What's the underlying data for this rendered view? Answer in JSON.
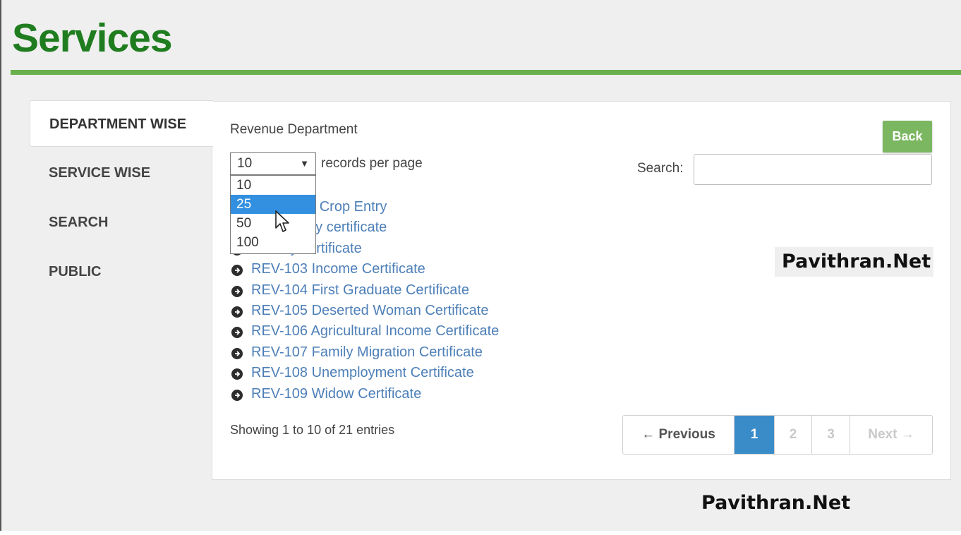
{
  "page": {
    "title": "Services"
  },
  "tabs": [
    {
      "label": "DEPARTMENT WISE",
      "active": true
    },
    {
      "label": "SERVICE WISE",
      "active": false
    },
    {
      "label": "SEARCH",
      "active": false
    },
    {
      "label": "PUBLIC",
      "active": false
    }
  ],
  "panel": {
    "department": "Revenue Department",
    "back_label": "Back",
    "per_page": {
      "value": "10",
      "label": "records per page",
      "options": [
        "10",
        "25",
        "50",
        "100"
      ],
      "highlighted": "25"
    },
    "search": {
      "label": "Search:",
      "value": ""
    },
    "services": [
      {
        "text": "e-Adangal Crop Entry"
      },
      {
        "text": "Community certificate"
      },
      {
        "text": "Nativity certificate"
      },
      {
        "text": "REV-103 Income Certificate"
      },
      {
        "text": "REV-104 First Graduate Certificate"
      },
      {
        "text": "REV-105 Deserted Woman Certificate"
      },
      {
        "text": "REV-106 Agricultural Income Certificate"
      },
      {
        "text": "REV-107 Family Migration Certificate"
      },
      {
        "text": "REV-108 Unemployment Certificate"
      },
      {
        "text": "REV-109 Widow Certificate"
      }
    ],
    "info": "Showing 1 to 10 of 21 entries",
    "pagination": {
      "previous": "← Previous",
      "pages": [
        "1",
        "2",
        "3"
      ],
      "current": "1",
      "next": "Next →"
    }
  },
  "watermarks": [
    "Pavithran.Net",
    "Pavithran.Net"
  ],
  "colors": {
    "title_green": "#1f7d1f",
    "rule_green": "#6ab04c",
    "back_button": "#7bb661",
    "link_blue": "#4d7fb8",
    "active_page": "#3a8cc9",
    "option_highlight": "#3390e0"
  },
  "icons": {
    "bullet": "arrow-circle-right-icon",
    "caret": "caret-down-icon",
    "cursor": "mouse-pointer-icon"
  }
}
